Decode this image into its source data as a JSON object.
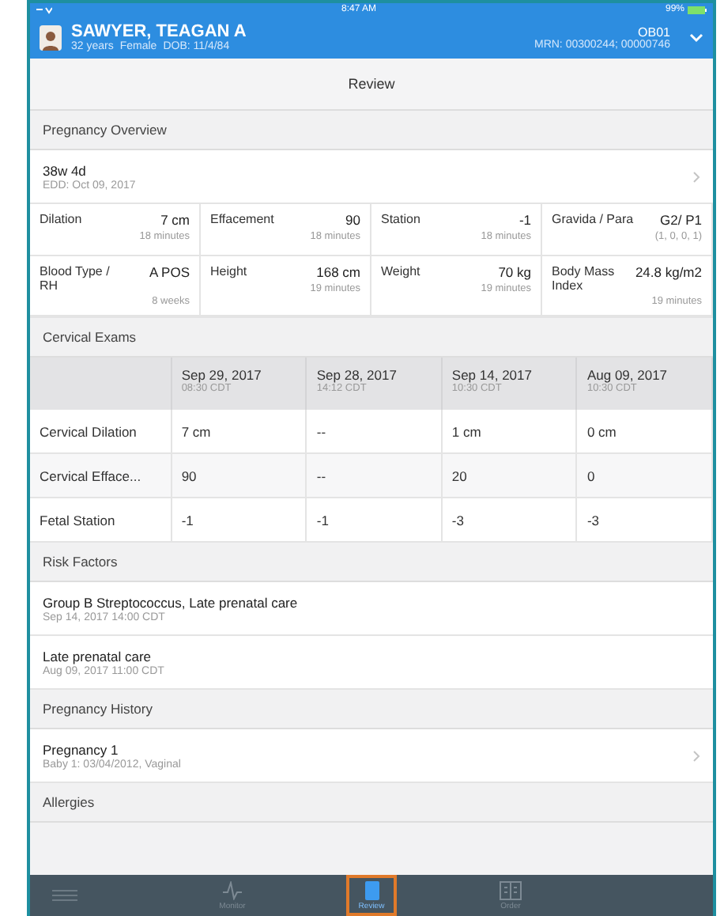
{
  "status_bar": {
    "time": "8:47 AM",
    "battery": "99%"
  },
  "patient": {
    "name": "SAWYER, TEAGAN A",
    "details": [
      "32 years",
      "Female",
      "DOB: 11/4/84"
    ],
    "location": "OB01",
    "mrn": "MRN: 00300244; 00000746"
  },
  "nav_title": "Review",
  "pregnancy_overview": {
    "title": "Pregnancy Overview",
    "summary": {
      "title": "38w 4d",
      "subtitle": "EDD: Oct 09, 2017",
      "chevron": true
    },
    "vitals": [
      {
        "label": "Dilation",
        "value": "7 cm",
        "note": "18 minutes"
      },
      {
        "label": "Effacement",
        "value": "90",
        "note": "18 minutes"
      },
      {
        "label": "Station",
        "value": "-1",
        "note": "18 minutes"
      },
      {
        "label": "Gravida / Para",
        "value": "G2/ P1",
        "note": "(1, 0, 0, 1)"
      },
      {
        "label": "Blood Type / RH",
        "value": "A POS",
        "note": "8 weeks"
      },
      {
        "label": "Height",
        "value": "168 cm",
        "note": "19 minutes"
      },
      {
        "label": "Weight",
        "value": "70 kg",
        "note": "19 minutes"
      },
      {
        "label": "Body Mass Index",
        "value": "24.8 kg/m2",
        "note": "19 minutes"
      }
    ]
  },
  "cervical_exams": {
    "title": "Cervical Exams",
    "columns": [
      {
        "date": "Sep 29, 2017",
        "time": "08:30 CDT"
      },
      {
        "date": "Sep 28, 2017",
        "time": "14:12 CDT"
      },
      {
        "date": "Sep 14, 2017",
        "time": "10:30 CDT"
      },
      {
        "date": "Aug 09, 2017",
        "time": "10:30 CDT"
      }
    ],
    "rows": [
      {
        "label": "Cervical Dilation",
        "values": [
          "7 cm",
          "--",
          "1 cm",
          "0 cm"
        ]
      },
      {
        "label": "Cervical Efface...",
        "values": [
          "90",
          "--",
          "20",
          "0"
        ]
      },
      {
        "label": "Fetal Station",
        "values": [
          "-1",
          "-1",
          "-3",
          "-3"
        ]
      }
    ]
  },
  "risk_factors": {
    "title": "Risk Factors",
    "items": [
      {
        "title": "Group B Streptococcus, Late prenatal care",
        "subtitle": "Sep 14, 2017 14:00 CDT",
        "chevron": false
      },
      {
        "title": "Late prenatal care",
        "subtitle": "Aug 09, 2017 11:00 CDT",
        "chevron": false
      }
    ]
  },
  "pregnancy_history": {
    "title": "Pregnancy History",
    "items": [
      {
        "title": "Pregnancy 1",
        "subtitle": "Baby 1: 03/04/2012, Vaginal",
        "chevron": true
      }
    ]
  },
  "allergies": {
    "title": "Allergies"
  },
  "tab_bar": [
    {
      "kind": "pulse",
      "label": "Monitor",
      "selected": false
    },
    {
      "kind": "document",
      "label": "Review",
      "selected": true
    },
    {
      "kind": "grid",
      "label": "Order",
      "selected": false
    }
  ]
}
